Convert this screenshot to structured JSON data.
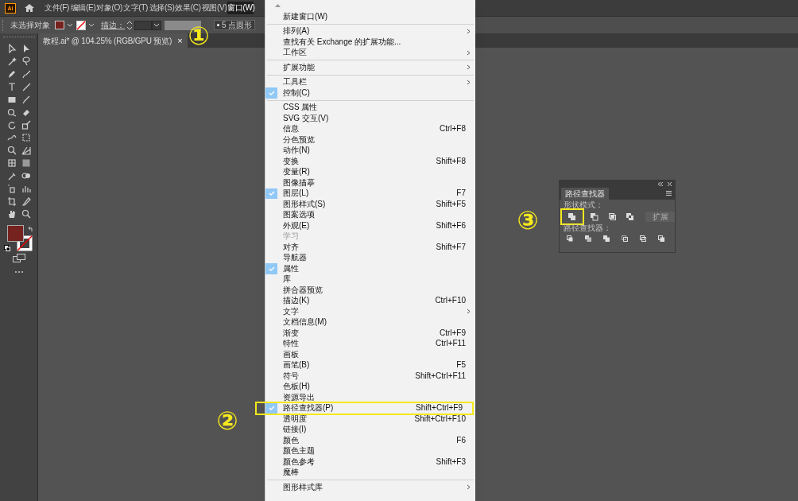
{
  "app_logo": "Ai",
  "menubar": [
    {
      "label": "文件(F)",
      "selected": false
    },
    {
      "label": "编辑(E)",
      "selected": false
    },
    {
      "label": "对象(O)",
      "selected": false
    },
    {
      "label": "文字(T)",
      "selected": false
    },
    {
      "label": "选择(S)",
      "selected": false
    },
    {
      "label": "效果(C)",
      "selected": false
    },
    {
      "label": "视图(V)",
      "selected": false
    },
    {
      "label": "窗口(W)",
      "selected": true
    }
  ],
  "control_bar": {
    "selection": "未选择对象",
    "stroke_label": "描边：",
    "brush": "5 点圆形"
  },
  "document_tab": {
    "title": "教程.ai* @ 104.25% (RGB/GPU 预览)",
    "close": "×"
  },
  "window_menu": [
    {
      "kind": "item",
      "label": "新建窗口(W)",
      "checked": false,
      "submenu": false,
      "disabled": false,
      "highlighted": false
    },
    {
      "kind": "separator"
    },
    {
      "kind": "item",
      "label": "排列(A)",
      "checked": false,
      "submenu": true,
      "disabled": false,
      "highlighted": false
    },
    {
      "kind": "item",
      "label": "查找有关 Exchange 的扩展功能...",
      "checked": false,
      "submenu": false,
      "disabled": false,
      "highlighted": false
    },
    {
      "kind": "item",
      "label": "工作区",
      "checked": false,
      "submenu": true,
      "disabled": false,
      "highlighted": false
    },
    {
      "kind": "separator"
    },
    {
      "kind": "item",
      "label": "扩展功能",
      "checked": false,
      "submenu": true,
      "disabled": false,
      "highlighted": false
    },
    {
      "kind": "separator"
    },
    {
      "kind": "item",
      "label": "工具栏",
      "checked": false,
      "submenu": true,
      "disabled": false,
      "highlighted": false
    },
    {
      "kind": "item",
      "label": "控制(C)",
      "checked": true,
      "submenu": false,
      "disabled": false,
      "highlighted": false
    },
    {
      "kind": "separator"
    },
    {
      "kind": "item",
      "label": "CSS 属性",
      "checked": false,
      "submenu": false,
      "disabled": false,
      "highlighted": false
    },
    {
      "kind": "item",
      "label": "SVG 交互(V)",
      "checked": false,
      "submenu": false,
      "disabled": false,
      "highlighted": false
    },
    {
      "kind": "item",
      "label": "信息",
      "shortcut": "Ctrl+F8",
      "checked": false,
      "submenu": false,
      "disabled": false,
      "highlighted": false
    },
    {
      "kind": "item",
      "label": "分色预览",
      "checked": false,
      "submenu": false,
      "disabled": false,
      "highlighted": false
    },
    {
      "kind": "item",
      "label": "动作(N)",
      "checked": false,
      "submenu": false,
      "disabled": false,
      "highlighted": false
    },
    {
      "kind": "item",
      "label": "变换",
      "shortcut": "Shift+F8",
      "checked": false,
      "submenu": false,
      "disabled": false,
      "highlighted": false
    },
    {
      "kind": "item",
      "label": "变量(R)",
      "checked": false,
      "submenu": false,
      "disabled": false,
      "highlighted": false
    },
    {
      "kind": "item",
      "label": "图像描摹",
      "checked": false,
      "submenu": false,
      "disabled": false,
      "highlighted": false
    },
    {
      "kind": "item",
      "label": "图层(L)",
      "shortcut": "F7",
      "checked": true,
      "submenu": false,
      "disabled": false,
      "highlighted": false
    },
    {
      "kind": "item",
      "label": "图形样式(S)",
      "shortcut": "Shift+F5",
      "checked": false,
      "submenu": false,
      "disabled": false,
      "highlighted": false
    },
    {
      "kind": "item",
      "label": "图案选项",
      "checked": false,
      "submenu": false,
      "disabled": false,
      "highlighted": false
    },
    {
      "kind": "item",
      "label": "外观(E)",
      "shortcut": "Shift+F6",
      "checked": false,
      "submenu": false,
      "disabled": false,
      "highlighted": false
    },
    {
      "kind": "item",
      "label": "学习",
      "checked": false,
      "submenu": false,
      "disabled": true,
      "highlighted": false
    },
    {
      "kind": "item",
      "label": "对齐",
      "shortcut": "Shift+F7",
      "checked": false,
      "submenu": false,
      "disabled": false,
      "highlighted": false
    },
    {
      "kind": "item",
      "label": "导航器",
      "checked": false,
      "submenu": false,
      "disabled": false,
      "highlighted": false
    },
    {
      "kind": "item",
      "label": "属性",
      "checked": true,
      "submenu": false,
      "disabled": false,
      "highlighted": false
    },
    {
      "kind": "item",
      "label": "库",
      "checked": false,
      "submenu": false,
      "disabled": false,
      "highlighted": false
    },
    {
      "kind": "item",
      "label": "拼合器预览",
      "checked": false,
      "submenu": false,
      "disabled": false,
      "highlighted": false
    },
    {
      "kind": "item",
      "label": "描边(K)",
      "shortcut": "Ctrl+F10",
      "checked": false,
      "submenu": false,
      "disabled": false,
      "highlighted": false
    },
    {
      "kind": "item",
      "label": "文字",
      "checked": false,
      "submenu": true,
      "disabled": false,
      "highlighted": false
    },
    {
      "kind": "item",
      "label": "文档信息(M)",
      "checked": false,
      "submenu": false,
      "disabled": false,
      "highlighted": false
    },
    {
      "kind": "item",
      "label": "渐变",
      "shortcut": "Ctrl+F9",
      "checked": false,
      "submenu": false,
      "disabled": false,
      "highlighted": false
    },
    {
      "kind": "item",
      "label": "特性",
      "shortcut": "Ctrl+F11",
      "checked": false,
      "submenu": false,
      "disabled": false,
      "highlighted": false
    },
    {
      "kind": "item",
      "label": "画板",
      "checked": false,
      "submenu": false,
      "disabled": false,
      "highlighted": false
    },
    {
      "kind": "item",
      "label": "画笔(B)",
      "shortcut": "F5",
      "checked": false,
      "submenu": false,
      "disabled": false,
      "highlighted": false
    },
    {
      "kind": "item",
      "label": "符号",
      "shortcut": "Shift+Ctrl+F11",
      "checked": false,
      "submenu": false,
      "disabled": false,
      "highlighted": false
    },
    {
      "kind": "item",
      "label": "色板(H)",
      "checked": false,
      "submenu": false,
      "disabled": false,
      "highlighted": false
    },
    {
      "kind": "item",
      "label": "资源导出",
      "checked": false,
      "submenu": false,
      "disabled": false,
      "highlighted": false
    },
    {
      "kind": "item",
      "label": "路径查找器(P)",
      "shortcut": "Shift+Ctrl+F9",
      "checked": true,
      "submenu": false,
      "disabled": false,
      "highlighted": true
    },
    {
      "kind": "item",
      "label": "透明度",
      "shortcut": "Shift+Ctrl+F10",
      "checked": false,
      "submenu": false,
      "disabled": false,
      "highlighted": false
    },
    {
      "kind": "item",
      "label": "链接(I)",
      "checked": false,
      "submenu": false,
      "disabled": false,
      "highlighted": false
    },
    {
      "kind": "item",
      "label": "颜色",
      "shortcut": "F6",
      "checked": false,
      "submenu": false,
      "disabled": false,
      "highlighted": false
    },
    {
      "kind": "item",
      "label": "颜色主题",
      "checked": false,
      "submenu": false,
      "disabled": false,
      "highlighted": false
    },
    {
      "kind": "item",
      "label": "颜色参考",
      "shortcut": "Shift+F3",
      "checked": false,
      "submenu": false,
      "disabled": false,
      "highlighted": false
    },
    {
      "kind": "item",
      "label": "魔棒",
      "checked": false,
      "submenu": false,
      "disabled": false,
      "highlighted": false
    },
    {
      "kind": "separator"
    },
    {
      "kind": "item",
      "label": "图形样式库",
      "checked": false,
      "submenu": true,
      "disabled": false,
      "highlighted": false
    }
  ],
  "pathfinder_panel": {
    "tab": "路径查找器",
    "shape_modes_label": "形状模式：",
    "shape_mode_buttons": [
      {
        "highlighted": true
      },
      {
        "highlighted": false
      },
      {
        "highlighted": false
      },
      {
        "highlighted": false
      }
    ],
    "expand_button": "扩展",
    "pathfinders_label": "路径查找器："
  },
  "annotations": [
    {
      "text": "①"
    },
    {
      "text": "②"
    },
    {
      "text": "③"
    }
  ]
}
